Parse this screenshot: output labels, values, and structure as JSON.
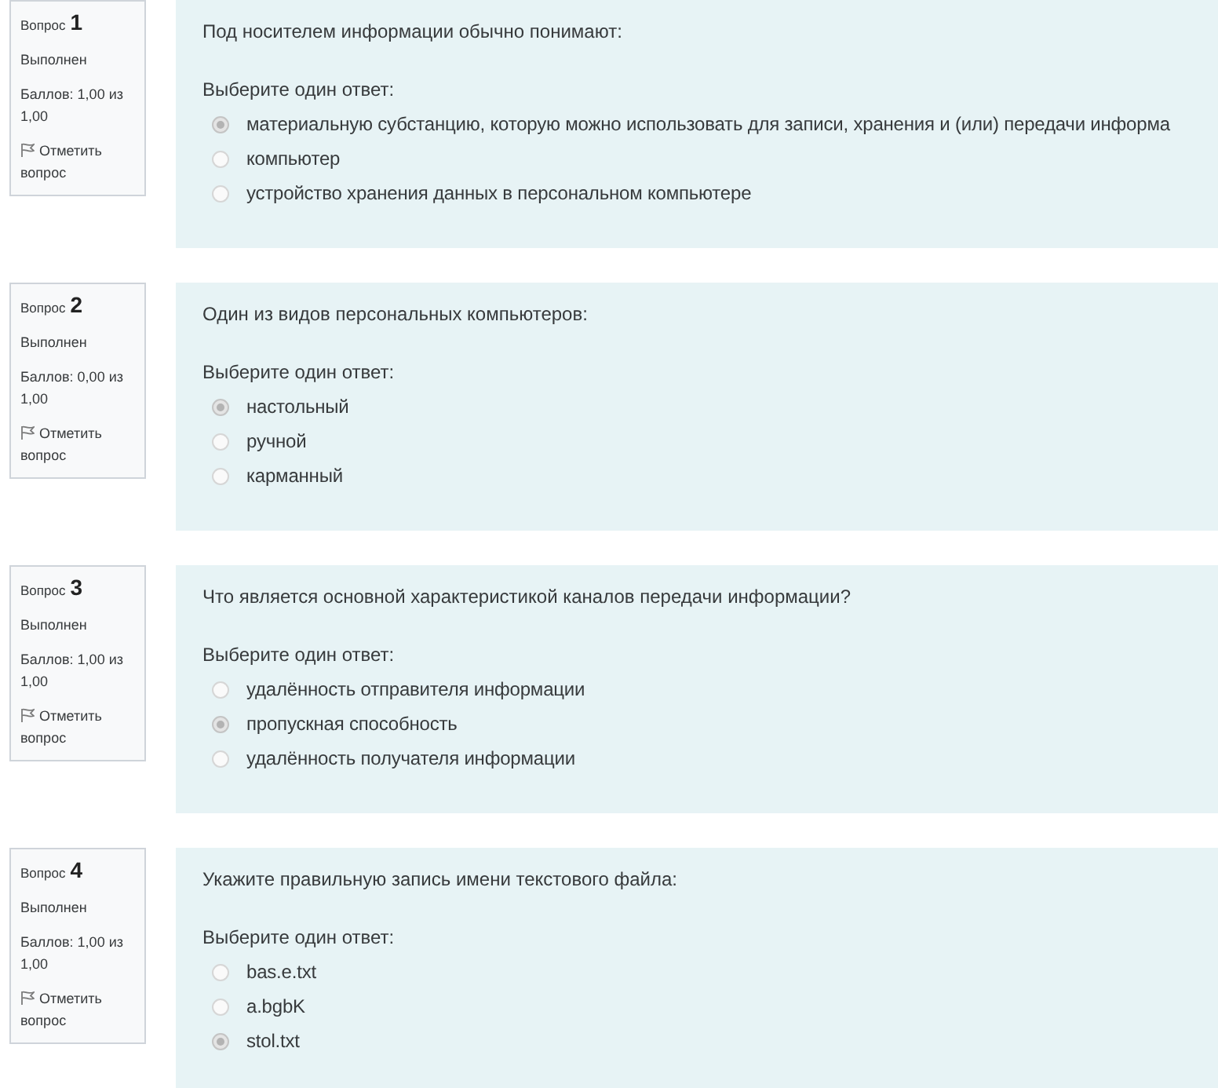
{
  "questions": [
    {
      "number_label": "Вопрос",
      "number": "1",
      "status": "Выполнен",
      "grade": "Баллов: 1,00 из 1,00",
      "flag_link": "Отметить вопрос",
      "text": "Под носителем информации обычно понимают:",
      "prompt": "Выберите один ответ:",
      "answers": [
        {
          "label": "материальную субстанцию, которую можно использовать для записи, хранения и (или) передачи информа",
          "selected": true
        },
        {
          "label": "компьютер",
          "selected": false
        },
        {
          "label": "устройство хранения данных в персональном компьютере",
          "selected": false
        }
      ]
    },
    {
      "number_label": "Вопрос",
      "number": "2",
      "status": "Выполнен",
      "grade": "Баллов: 0,00 из 1,00",
      "flag_link": "Отметить вопрос",
      "text": "Один из видов персональных компьютеров:",
      "prompt": "Выберите один ответ:",
      "answers": [
        {
          "label": "настольный",
          "selected": true
        },
        {
          "label": "ручной",
          "selected": false
        },
        {
          "label": "карманный",
          "selected": false
        }
      ]
    },
    {
      "number_label": "Вопрос",
      "number": "3",
      "status": "Выполнен",
      "grade": "Баллов: 1,00 из 1,00",
      "flag_link": "Отметить вопрос",
      "text": "Что является основной характеристикой каналов передачи информации?",
      "prompt": "Выберите один ответ:",
      "answers": [
        {
          "label": "удалённость отправителя информации",
          "selected": false
        },
        {
          "label": "пропускная способность",
          "selected": true
        },
        {
          "label": "удалённость получателя информации",
          "selected": false
        }
      ]
    },
    {
      "number_label": "Вопрос",
      "number": "4",
      "status": "Выполнен",
      "grade": "Баллов: 1,00 из 1,00",
      "flag_link": "Отметить вопрос",
      "text": "Укажите правильную запись имени текстового файла:",
      "prompt": "Выберите один ответ:",
      "answers": [
        {
          "label": "bas.e.txt",
          "selected": false
        },
        {
          "label": "a.bgbK",
          "selected": false
        },
        {
          "label": "stol.txt",
          "selected": true
        }
      ]
    }
  ]
}
